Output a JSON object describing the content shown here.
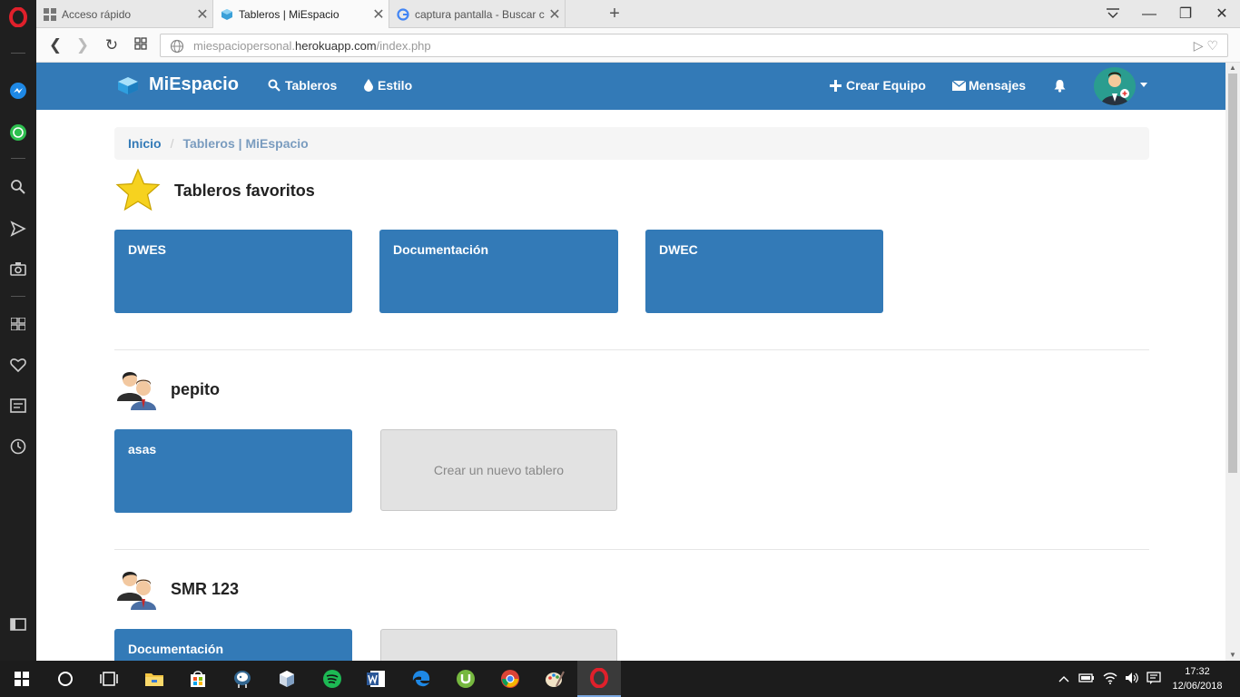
{
  "browser": {
    "tabs": [
      {
        "title": "Acceso rápido",
        "active": false
      },
      {
        "title": "Tableros | MiEspacio",
        "active": true
      },
      {
        "title": "captura pantalla - Buscar c",
        "active": false
      }
    ],
    "url_prefix": "miespaciopersonal.",
    "url_domain": "herokuapp.com",
    "url_path": "/index.php"
  },
  "app": {
    "brand": "MiEspacio",
    "nav": {
      "tableros": "Tableros",
      "estilo": "Estilo",
      "crear_equipo": "Crear Equipo",
      "mensajes": "Mensajes"
    },
    "breadcrumb": {
      "home": "Inicio",
      "separator": "/",
      "current": "Tableros | MiEspacio"
    },
    "favorites": {
      "title": "Tableros favoritos",
      "boards": [
        "DWES",
        "Documentación",
        "DWEC"
      ]
    },
    "teams": [
      {
        "name": "pepito",
        "boards": [
          "asas"
        ],
        "new_board_label": "Crear un nuevo tablero"
      },
      {
        "name": "SMR 123",
        "boards": [
          "Documentación"
        ],
        "new_board_label": ""
      }
    ],
    "colors": {
      "primary": "#337ab7",
      "breadcrumb_bg": "#f5f5f5"
    }
  },
  "taskbar": {
    "time": "17:32",
    "date": "12/06/2018"
  }
}
